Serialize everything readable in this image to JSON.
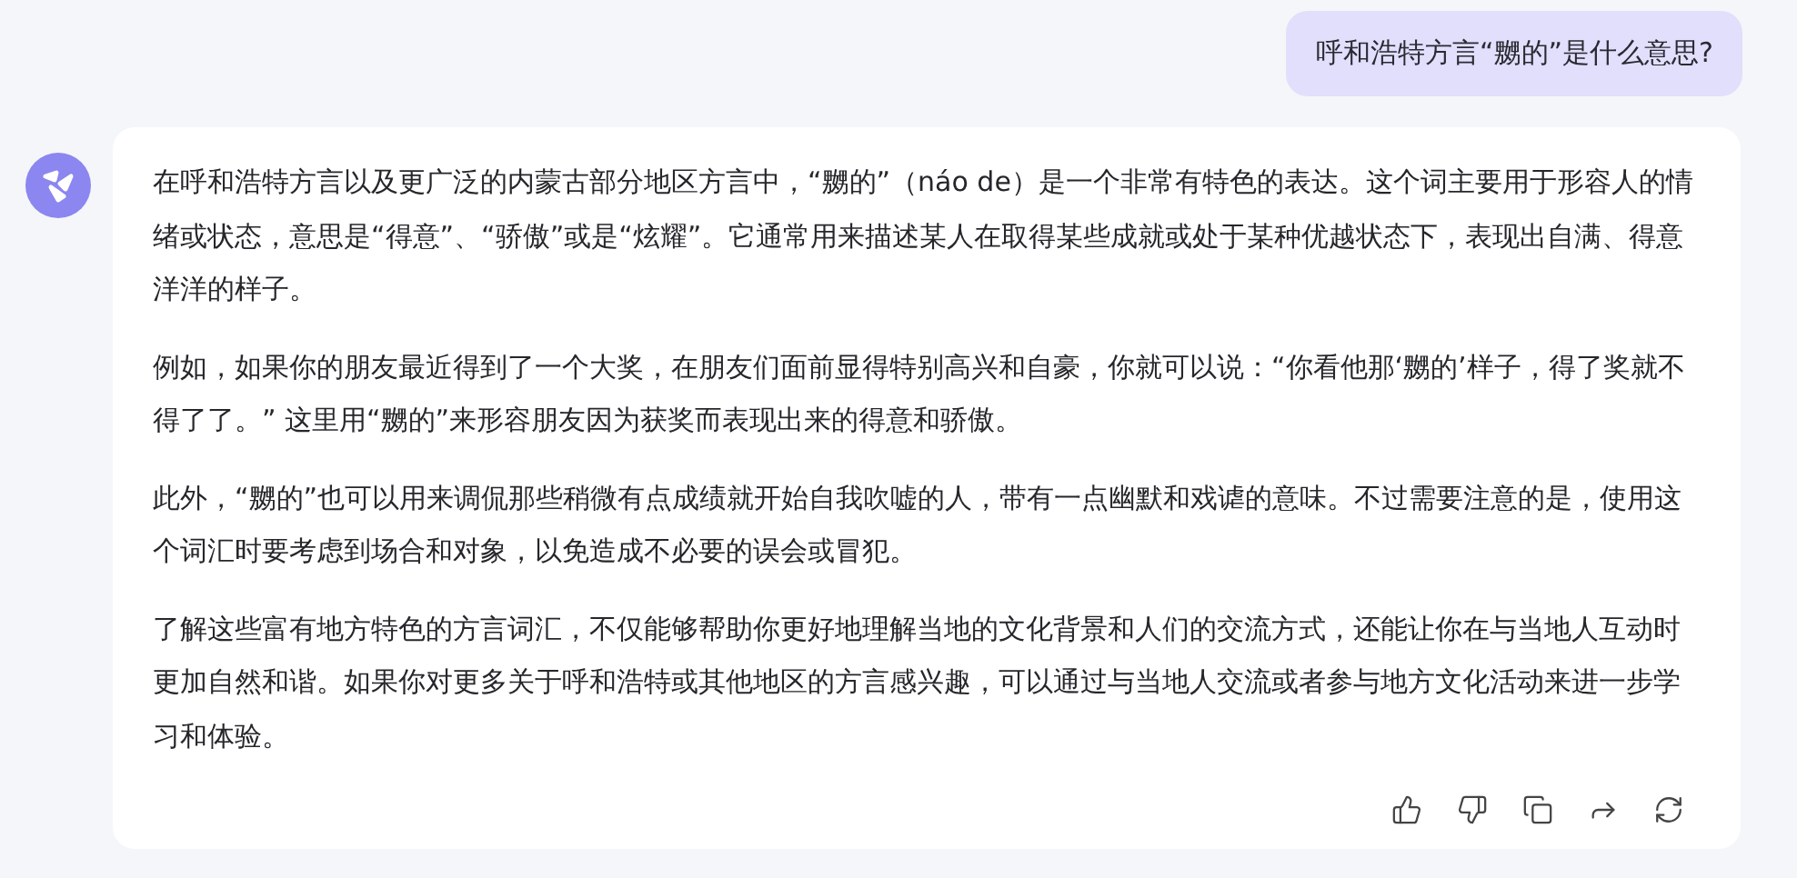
{
  "user_message": {
    "text": "呼和浩特方言“嬲的”是什么意思?"
  },
  "answer": {
    "paragraphs": [
      "在呼和浩特方言以及更广泛的内蒙古部分地区方言中，“嬲的”（náo de）是一个非常有特色的表达。这个词主要用于形容人的情绪或状态，意思是“得意”、“骄傲”或是“炫耀”。它通常用来描述某人在取得某些成就或处于某种优越状态下，表现出自满、得意洋洋的样子。",
      "例如，如果你的朋友最近得到了一个大奖，在朋友们面前显得特别高兴和自豪，你就可以说：“你看他那‘嬲的’样子，得了奖就不得了了。” 这里用“嬲的”来形容朋友因为获奖而表现出来的得意和骄傲。",
      "此外，“嬲的”也可以用来调侃那些稍微有点成绩就开始自我吹嘘的人，带有一点幽默和戏谑的意味。不过需要注意的是，使用这个词汇时要考虑到场合和对象，以免造成不必要的误会或冒犯。",
      "了解这些富有地方特色的方言词汇，不仅能够帮助你更好地理解当地的文化背景和人们的交流方式，还能让你在与当地人互动时更加自然和谐。如果你对更多关于呼和浩特或其他地区的方言感兴趣，可以通过与当地人交流或者参与地方文化活动来进一步学习和体验。"
    ]
  }
}
